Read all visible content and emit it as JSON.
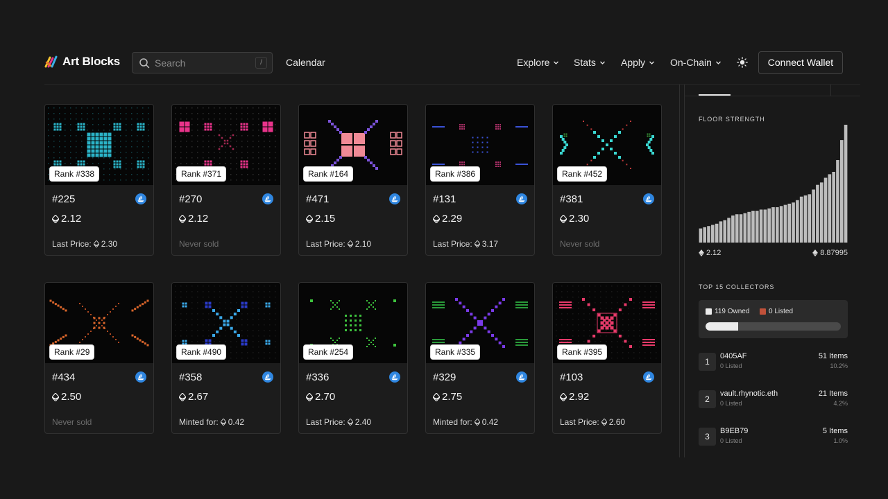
{
  "header": {
    "logo_text": "Art Blocks",
    "search_placeholder": "Search",
    "search_shortcut": "/",
    "calendar_label": "Calendar",
    "nav": [
      {
        "label": "Explore"
      },
      {
        "label": "Stats"
      },
      {
        "label": "Apply"
      },
      {
        "label": "On-Chain"
      }
    ],
    "connect_label": "Connect Wallet"
  },
  "cards": [
    {
      "rank": "Rank #338",
      "token": "#225",
      "price": "2.12",
      "sale_label": "Last Price:",
      "sale_value": "2.30",
      "art_color": "#2bb3c7",
      "pattern": "center-block"
    },
    {
      "rank": "Rank #371",
      "token": "#270",
      "price": "2.12",
      "sale_label": "Never sold",
      "sale_value": "",
      "art_color": "#e8338a",
      "pattern": "corners-x"
    },
    {
      "rank": "Rank #164",
      "token": "#471",
      "price": "2.15",
      "sale_label": "Last Price:",
      "sale_value": "2.10",
      "art_color": "#f08a96",
      "pattern": "block-diag"
    },
    {
      "rank": "Rank #386",
      "token": "#131",
      "price": "2.29",
      "sale_label": "Last Price:",
      "sale_value": "3.17",
      "art_color": "#3a52d6",
      "pattern": "sparse"
    },
    {
      "rank": "Rank #452",
      "token": "#381",
      "price": "2.30",
      "sale_label": "Never sold",
      "sale_value": "",
      "art_color": "#3ad6d0",
      "pattern": "x-chevrons"
    },
    {
      "rank": "Rank #29",
      "token": "#434",
      "price": "2.50",
      "sale_label": "Never sold",
      "sale_value": "",
      "art_color": "#d9652a",
      "pattern": "x-dotted"
    },
    {
      "rank": "Rank #490",
      "token": "#358",
      "price": "2.67",
      "sale_label": "Minted for:",
      "sale_value": "0.42",
      "art_color": "#3aa8e8",
      "pattern": "x-squares"
    },
    {
      "rank": "Rank #254",
      "token": "#336",
      "price": "2.70",
      "sale_label": "Last Price:",
      "sale_value": "2.40",
      "art_color": "#3ec43e",
      "pattern": "grid-center"
    },
    {
      "rank": "Rank #335",
      "token": "#329",
      "price": "2.75",
      "sale_label": "Minted for:",
      "sale_value": "0.42",
      "art_color": "#7a3ae8",
      "pattern": "x-lines"
    },
    {
      "rank": "Rank #395",
      "token": "#103",
      "price": "2.92",
      "sale_label": "Last Price:",
      "sale_value": "2.60",
      "art_color": "#e83a6a",
      "pattern": "x-blocks"
    }
  ],
  "panel": {
    "floor_strength_label": "FLOOR STRENGTH",
    "floor_min": "2.12",
    "floor_max": "8.87995",
    "floor_bars": [
      0.12,
      0.13,
      0.14,
      0.15,
      0.16,
      0.18,
      0.19,
      0.21,
      0.23,
      0.24,
      0.24,
      0.25,
      0.26,
      0.27,
      0.27,
      0.28,
      0.28,
      0.29,
      0.3,
      0.3,
      0.31,
      0.32,
      0.33,
      0.34,
      0.36,
      0.39,
      0.4,
      0.41,
      0.45,
      0.49,
      0.51,
      0.55,
      0.58,
      0.6,
      0.7,
      0.87,
      1.0
    ],
    "top_collectors_label": "TOP 15 COLLECTORS",
    "owned_label": "119 Owned",
    "listed_label": "0 Listed",
    "owned_color": "#ececec",
    "listed_color": "#c0513a",
    "owned_fraction": 0.24,
    "collectors": [
      {
        "rank": "1",
        "name": "0405AF",
        "listed": "0 Listed",
        "items": "51 Items",
        "pct": "10.2%"
      },
      {
        "rank": "2",
        "name": "vault.rhynotic.eth",
        "listed": "0 Listed",
        "items": "21 Items",
        "pct": "4.2%"
      },
      {
        "rank": "3",
        "name": "B9EB79",
        "listed": "0 Listed",
        "items": "5 Items",
        "pct": "1.0%"
      }
    ]
  }
}
